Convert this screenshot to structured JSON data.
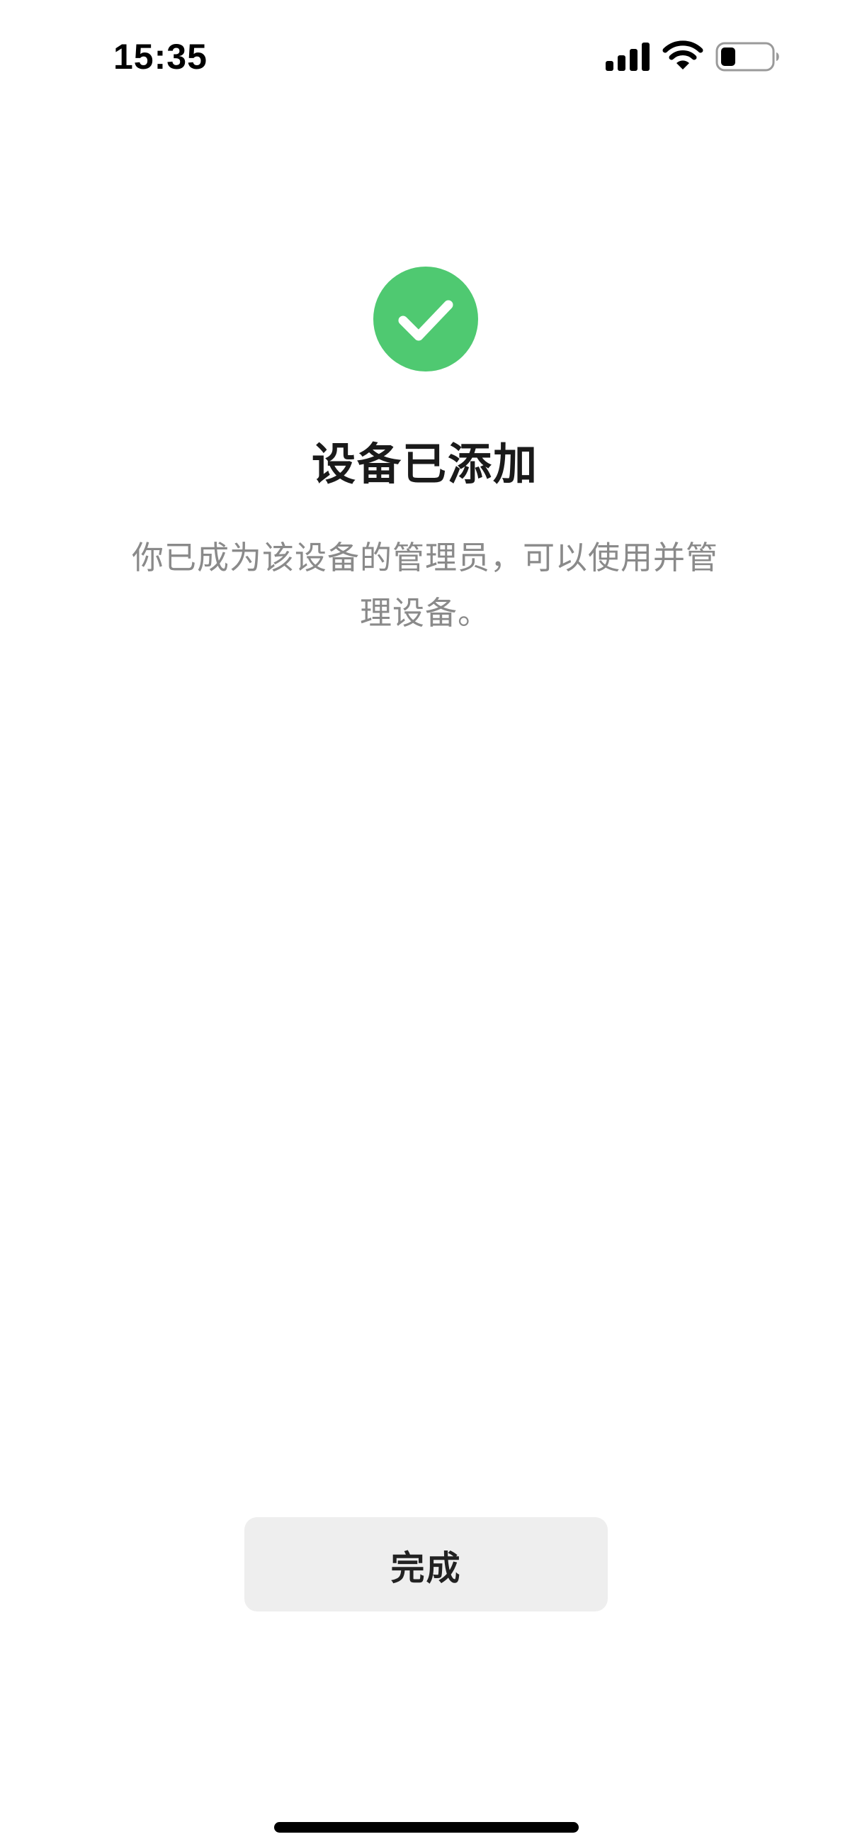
{
  "status_bar": {
    "time": "15:35",
    "icons": [
      "signal-icon",
      "wifi-icon",
      "battery-icon"
    ]
  },
  "success": {
    "icon": "checkmark-circle-icon",
    "color": "#4fc971"
  },
  "title": "设备已添加",
  "description": "你已成为该设备的管理员，可以使用并管理设备。",
  "done_button": {
    "label": "完成"
  }
}
